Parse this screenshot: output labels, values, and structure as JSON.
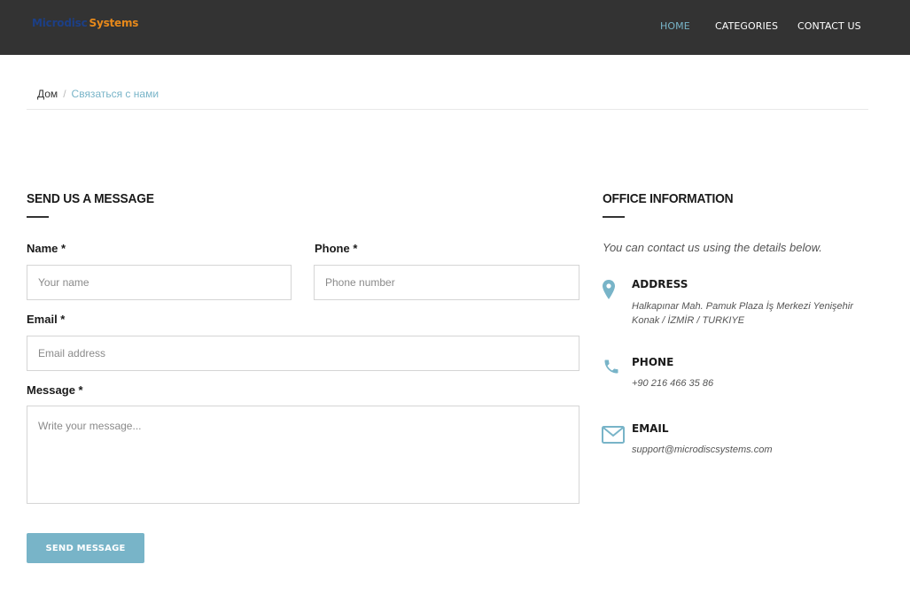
{
  "header": {
    "logo_part1": "Microdisc",
    "logo_part2": "Systems",
    "nav": [
      {
        "label": "HOME",
        "active": true
      },
      {
        "label": "CATEGORIES",
        "active": false
      },
      {
        "label": "CONTACT US",
        "active": false
      }
    ]
  },
  "breadcrumb": {
    "home": "Дом",
    "separator": "/",
    "current": "Связаться с нами"
  },
  "form": {
    "title": "SEND US A MESSAGE",
    "name_label": "Name *",
    "name_placeholder": "Your name",
    "phone_label": "Phone *",
    "phone_placeholder": "Phone number",
    "email_label": "Email *",
    "email_placeholder": "Email address",
    "message_label": "Message *",
    "message_placeholder": "Write your message...",
    "submit_label": "SEND MESSAGE"
  },
  "office": {
    "title": "OFFICE INFORMATION",
    "intro": "You can contact us using the details below.",
    "address_title": "ADDRESS",
    "address_line1": "Halkapınar Mah. Pamuk Plaza İş Merkezi Yenişehir",
    "address_line2": "Konak / İZMİR / TURKIYE",
    "phone_title": "PHONE",
    "phone_value": "+90 216 466 35 86",
    "email_title": "EMAIL",
    "email_value": "support@microdiscsystems.com"
  },
  "colors": {
    "accent": "#78b4c8",
    "header_bg": "#333333",
    "logo_blue": "#1c3f86",
    "logo_orange": "#e8891a"
  },
  "icons": {
    "address": "map-pin-icon",
    "phone": "phone-icon",
    "email": "envelope-icon"
  }
}
